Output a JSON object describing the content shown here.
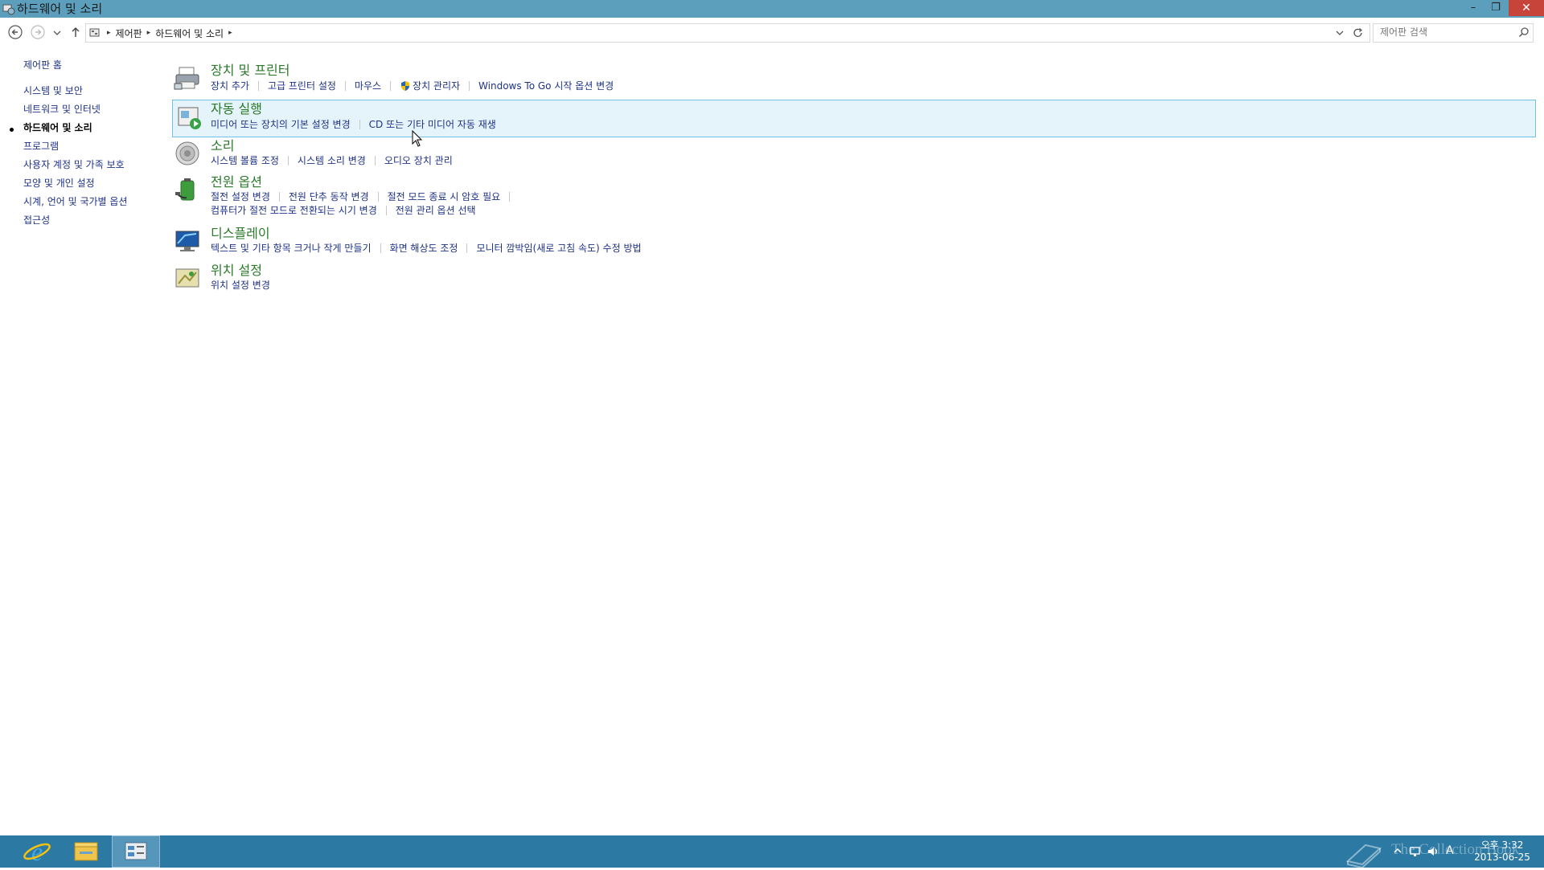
{
  "window": {
    "title": "하드웨어 및 소리",
    "controls": {
      "minimize": "–",
      "restore": "❐",
      "close": "✕"
    }
  },
  "address_bar": {
    "breadcrumbs": [
      "제어판",
      "하드웨어 및 소리"
    ],
    "search_placeholder": "제어판 검색"
  },
  "left_nav": {
    "home": "제어판 홈",
    "items": [
      {
        "label": "시스템 및 보안",
        "active": false
      },
      {
        "label": "네트워크 및 인터넷",
        "active": false
      },
      {
        "label": "하드웨어 및 소리",
        "active": true
      },
      {
        "label": "프로그램",
        "active": false
      },
      {
        "label": "사용자 계정 및 가족 보호",
        "active": false
      },
      {
        "label": "모양 및 개인 설정",
        "active": false
      },
      {
        "label": "시계, 언어 및 국가별 옵션",
        "active": false
      },
      {
        "label": "접근성",
        "active": false
      }
    ]
  },
  "categories": [
    {
      "title": "장치 및 프린터",
      "icon": "printer-icon",
      "links": [
        "장치 추가",
        "고급 프린터 설정",
        "마우스",
        "장치 관리자",
        "Windows To Go 시작 옵션 변경"
      ]
    },
    {
      "title": "자동 실행",
      "icon": "autoplay-icon",
      "links": [
        "미디어 또는 장치의 기본 설정 변경",
        "CD 또는 기타 미디어 자동 재생"
      ]
    },
    {
      "title": "소리",
      "icon": "speaker-icon",
      "links": [
        "시스템 볼륨 조정",
        "시스템 소리 변경",
        "오디오 장치 관리"
      ]
    },
    {
      "title": "전원 옵션",
      "icon": "battery-icon",
      "links": [
        "절전 설정 변경",
        "전원 단추 동작 변경",
        "절전 모드 종료 시 암호 필요"
      ],
      "links2": [
        "컴퓨터가 절전 모드로 전환되는 시기 변경",
        "전원 관리 옵션 선택"
      ]
    },
    {
      "title": "디스플레이",
      "icon": "display-icon",
      "links": [
        "텍스트 및 기타 항목 크거나 작게 만들기",
        "화면 해상도 조정",
        "모니터 깜박임(새로 고침 속도) 수정 방법"
      ]
    },
    {
      "title": "위치 설정",
      "icon": "location-icon",
      "links": [
        "위치 설정 변경"
      ]
    }
  ],
  "taskbar": {
    "apps": [
      "internet-explorer-icon",
      "file-explorer-icon",
      "control-panel-icon"
    ],
    "tray": {
      "ime": "A"
    },
    "clock": {
      "time": "오후 3:32",
      "date": "2013-06-25"
    },
    "watermark": "The Collection Book"
  },
  "colors": {
    "titlebar": "#5b9fbd",
    "taskbar": "#2c79a3",
    "link": "#1e3287",
    "category_title": "#2a7a2a",
    "hover_bg": "#e5f3fb",
    "hover_border": "#70c0e7"
  }
}
